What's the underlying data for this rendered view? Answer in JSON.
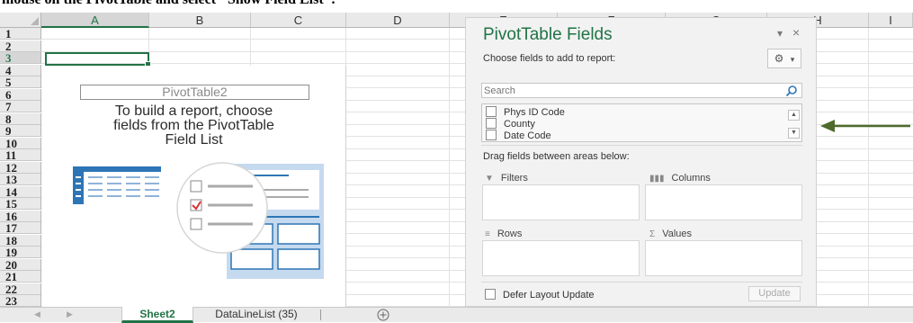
{
  "caption": "mouse on the PivotTable and select \"Show Field List\".",
  "grid": {
    "columns": [
      "A",
      "B",
      "C",
      "D",
      "E",
      "F",
      "G",
      "H",
      "I"
    ],
    "rows": [
      "1",
      "2",
      "3",
      "4",
      "5",
      "6",
      "7",
      "8",
      "9",
      "10",
      "11",
      "12",
      "13",
      "14",
      "15",
      "16",
      "17",
      "18",
      "19",
      "20",
      "21",
      "22",
      "23"
    ],
    "active_column": "A",
    "active_row": "3"
  },
  "pivot": {
    "name": "PivotTable2",
    "message_lines": [
      "To build a report, choose",
      "fields from the PivotTable",
      "Field List"
    ]
  },
  "field_pane": {
    "title": "PivotTable Fields",
    "choose_label": "Choose fields to add to report:",
    "search_placeholder": "Search",
    "fields": [
      "Phys ID Code",
      "County",
      "Date Code"
    ],
    "drag_label": "Drag fields between areas below:",
    "areas": {
      "filters": "Filters",
      "columns": "Columns",
      "rows": "Rows",
      "values": "Values"
    },
    "defer_label": "Defer Layout Update",
    "update_label": "Update"
  },
  "sheet_tabs": [
    {
      "label": "Sheet2",
      "active": true
    },
    {
      "label": "DataLineList (35)",
      "active": false
    }
  ],
  "colors": {
    "accent": "#217346",
    "arrow": "#4e6b2c"
  },
  "icons": [
    "search-icon",
    "gear-icon",
    "dropdown-icon",
    "close-icon",
    "filter-icon",
    "columns-icon",
    "rows-icon",
    "sigma-icon",
    "add-sheet-icon",
    "arrow-icon"
  ]
}
